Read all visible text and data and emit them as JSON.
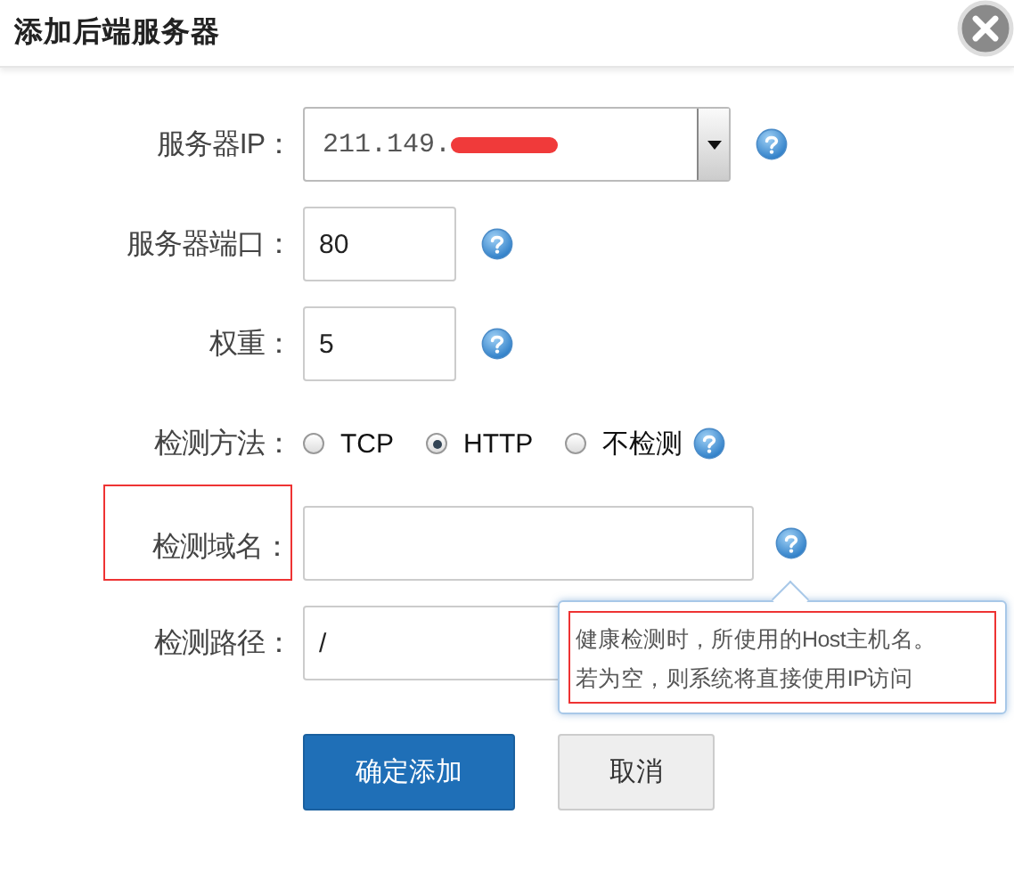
{
  "dialog": {
    "title": "添加后端服务器"
  },
  "fields": [
    {
      "kind": "select",
      "label": "服务器IP：",
      "value": "211.149.",
      "redacted": true,
      "help": true
    },
    {
      "kind": "short",
      "label": "服务器端口：",
      "value": "80",
      "help": true
    },
    {
      "kind": "short",
      "label": "权重：",
      "value": "5",
      "help": true
    },
    {
      "kind": "radio",
      "label": "检测方法：",
      "options": [
        {
          "label": "TCP",
          "selected": false
        },
        {
          "label": "HTTP",
          "selected": true
        },
        {
          "label": "不检测",
          "selected": false
        }
      ],
      "help": true
    },
    {
      "kind": "wide",
      "label": "检测域名：",
      "highlighted": true,
      "help": true,
      "tooltip": {
        "lines": [
          "健康检测时，所使用的Host主机名。",
          "若为空，则系统将直接使用IP访问"
        ],
        "highlighted": true
      }
    },
    {
      "kind": "wide",
      "label": "检测路径：",
      "value": "/"
    }
  ],
  "buttons": [
    {
      "label": "确定添加",
      "kind": "primary"
    },
    {
      "label": "取消",
      "kind": "secondary"
    }
  ]
}
